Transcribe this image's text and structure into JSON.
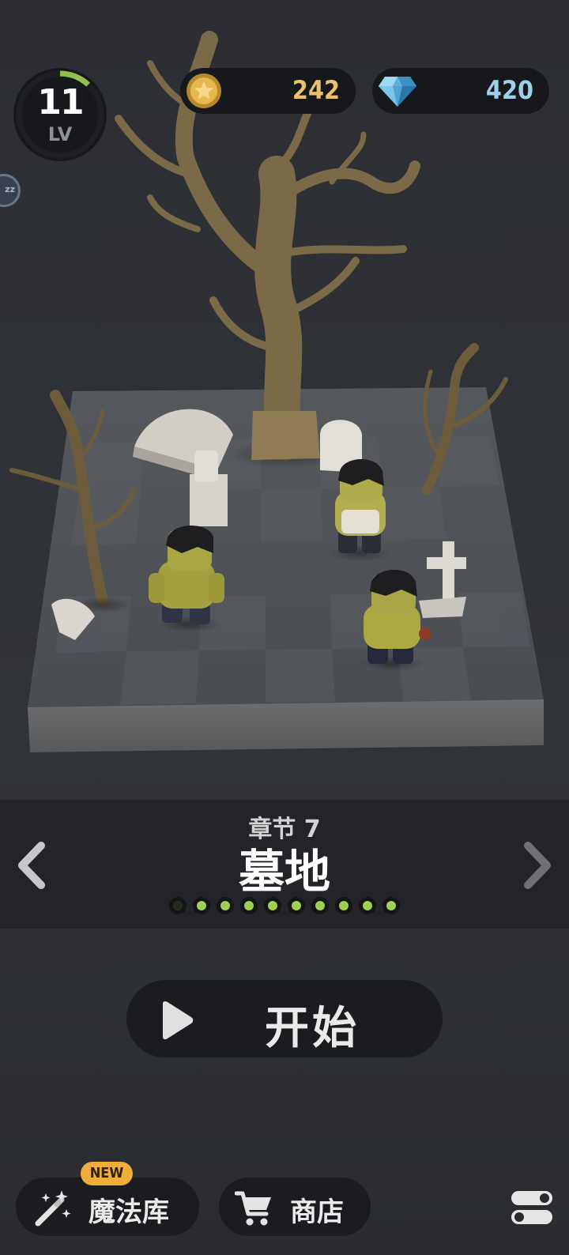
{
  "player": {
    "level": "11",
    "level_label": "LV",
    "level_progress": 0.12
  },
  "currency": {
    "coins": "242",
    "gems": "420"
  },
  "sleep": {
    "icon": "zz-icon",
    "label": "zz"
  },
  "chapter": {
    "label": "章节 7",
    "title": "墓地",
    "pages_total": 10,
    "current_page": 1
  },
  "start": {
    "label": "开始"
  },
  "bottom_nav": {
    "magic": {
      "label": "魔法库",
      "badge": "NEW"
    },
    "shop": {
      "label": "商店"
    }
  },
  "colors": {
    "accent_green": "#9ccf52",
    "coin_gold": "#e8c36a",
    "gem_blue": "#9fd0ea",
    "badge_orange": "#f0ad3a"
  }
}
